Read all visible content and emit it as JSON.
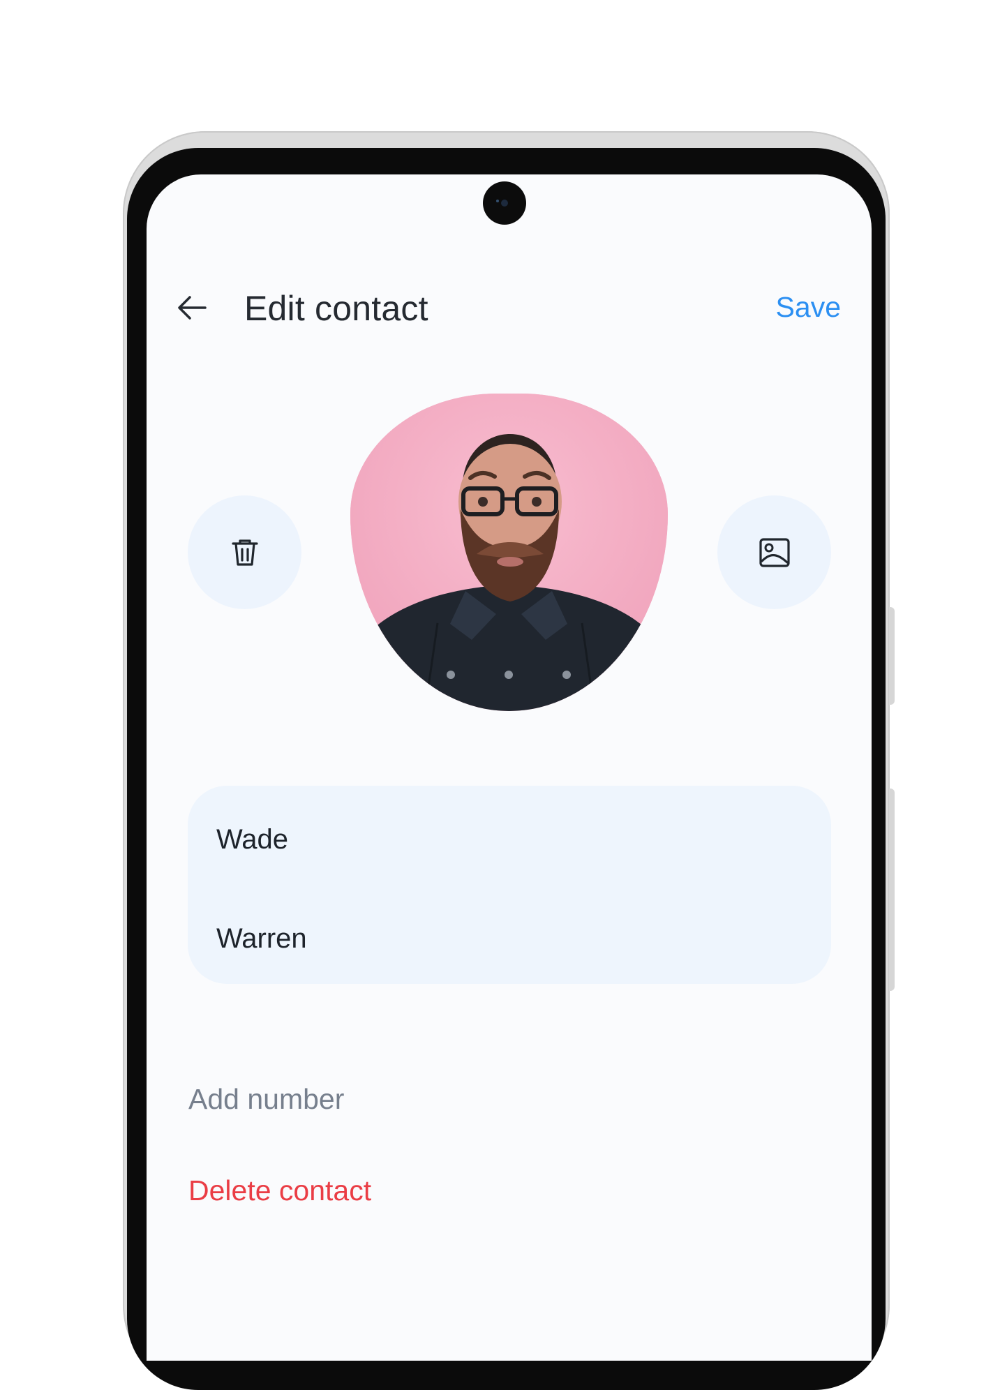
{
  "header": {
    "title": "Edit contact",
    "save_label": "Save"
  },
  "contact": {
    "first_name": "Wade",
    "last_name": "Warren"
  },
  "actions": {
    "add_number_label": "Add number",
    "delete_contact_label": "Delete contact"
  },
  "icons": {
    "back": "arrow-left-icon",
    "delete_photo": "trash-icon",
    "change_photo": "image-icon"
  },
  "colors": {
    "accent": "#2b8ff2",
    "danger": "#ea3d45",
    "muted": "#767f8d",
    "screen_bg": "#fafbfd",
    "card_bg": "#eef5fd",
    "avatar_bg": "#f4adc3"
  }
}
